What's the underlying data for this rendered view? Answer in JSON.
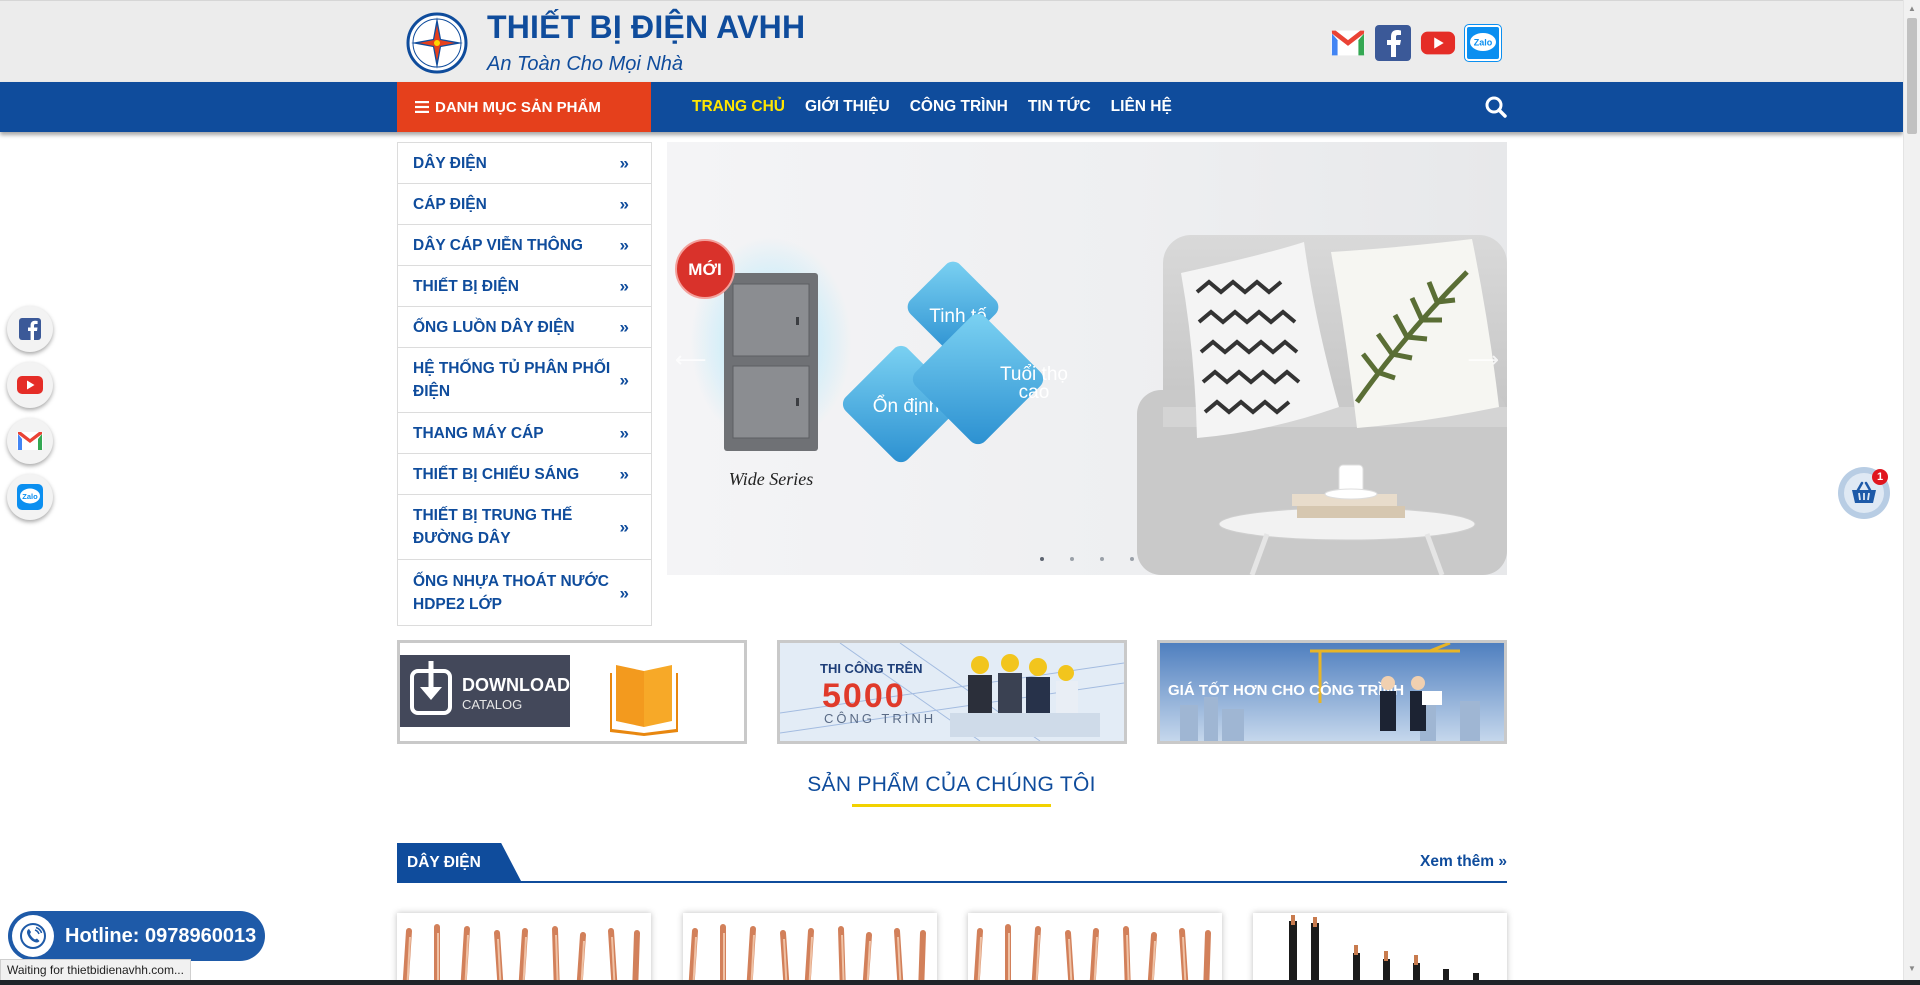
{
  "header": {
    "site_title": "THIẾT BỊ ĐIỆN AVHH",
    "slogan": "An Toàn Cho Mọi Nhà",
    "social_icons": [
      "gmail-icon",
      "facebook-icon",
      "youtube-icon",
      "zalo-icon"
    ]
  },
  "nav": {
    "category_button": "DANH MỤC SẢN PHẨM",
    "links": [
      "TRANG CHỦ",
      "GIỚI THIỆU",
      "CÔNG TRÌNH",
      "TIN TỨC",
      "LIÊN HỆ"
    ],
    "active_link": "TRANG CHỦ"
  },
  "categories": [
    "DÂY ĐIỆN",
    "CÁP ĐIỆN",
    "DÂY CÁP VIỄN THÔNG",
    "THIẾT BỊ ĐIỆN",
    "ỐNG LUỒN DÂY ĐIỆN",
    "HỆ THỐNG TỦ PHÂN PHỐI ĐIỆN",
    "THANG MÁY CÁP",
    "THIẾT BỊ CHIẾU SÁNG",
    "THIẾT BỊ TRUNG THẾ ĐƯỜNG DÂY",
    "ỐNG NHỰA THOÁT NƯỚC HDPE2 LỚP"
  ],
  "slider": {
    "badge": "MỚI",
    "product_caption": "Wide Series",
    "diamonds": [
      "Tinh tế",
      "Ổn định",
      "Tuổi thọ cao"
    ],
    "slide_count": 4,
    "active_slide": 1
  },
  "banners": {
    "catalog": {
      "line1": "DOWNLOAD",
      "line2": "CATALOG"
    },
    "projects": {
      "line1": "THI CÔNG TRÊN",
      "number": "5000",
      "line2": "CÔNG TRÌNH"
    },
    "price": {
      "text": "GIÁ TỐT HƠN CHO CÔNG TRÌNH"
    }
  },
  "section_title": "SẢN PHẨM CỦA CHÚNG TÔI",
  "product_section": {
    "tab_label": "DÂY ĐIỆN",
    "more_link": "Xem thêm »"
  },
  "cart": {
    "count": "1"
  },
  "hotline": {
    "label": "Hotline: 0978960013"
  },
  "status_bar": "Waiting for thietbidienavhh.com...",
  "colors": {
    "brand_blue": "#0f4c9c",
    "accent_orange": "#e5401c",
    "active_yellow": "#ffe600"
  }
}
